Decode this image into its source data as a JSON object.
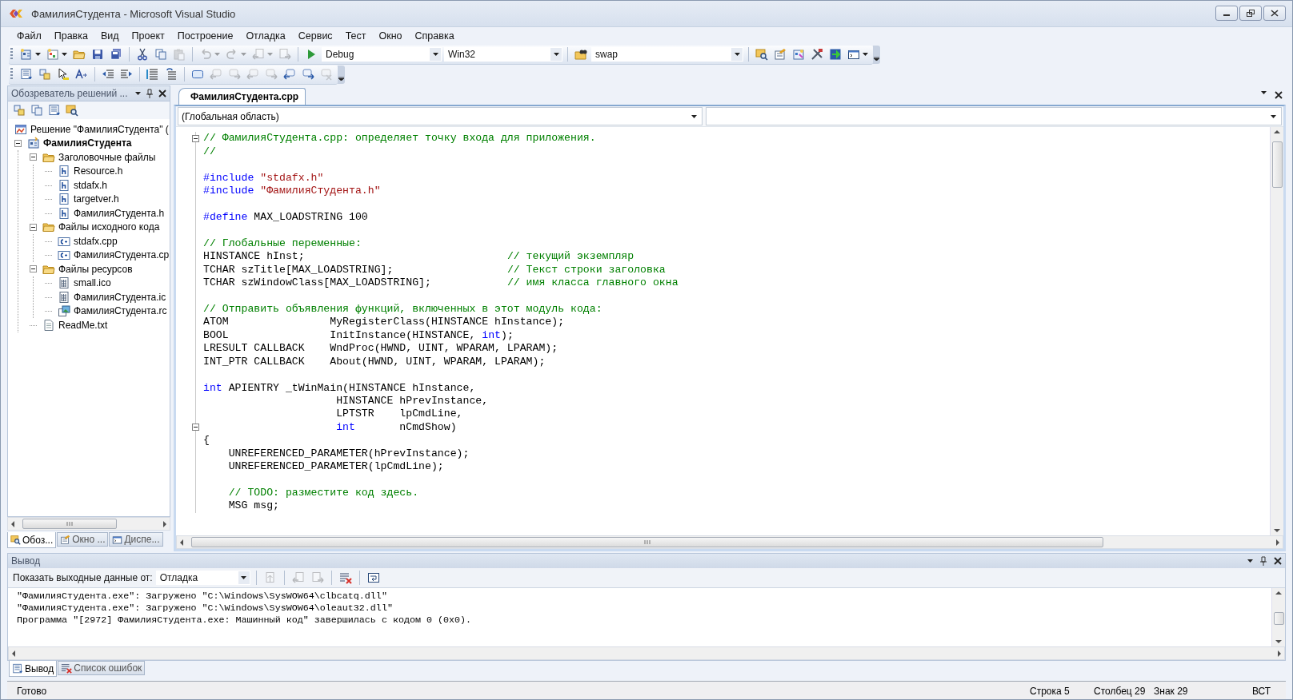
{
  "window": {
    "title": "ФамилияСтудента - Microsoft Visual Studio"
  },
  "menu": [
    "Файл",
    "Правка",
    "Вид",
    "Проект",
    "Построение",
    "Отладка",
    "Сервис",
    "Тест",
    "Окно",
    "Справка"
  ],
  "toolbar_standard": [
    {
      "kind": "button",
      "disabled": false,
      "dropdown": true
    },
    {
      "kind": "button",
      "disabled": false,
      "dropdown": true
    },
    {
      "kind": "button",
      "disabled": false,
      "dropdown": false
    },
    {
      "kind": "button",
      "disabled": false,
      "dropdown": false
    },
    {
      "kind": "button",
      "disabled": false,
      "dropdown": false
    },
    {
      "kind": "separator"
    },
    {
      "kind": "button",
      "disabled": false,
      "dropdown": false
    },
    {
      "kind": "button",
      "disabled": false,
      "dropdown": false
    },
    {
      "kind": "button",
      "disabled": true,
      "dropdown": false
    },
    {
      "kind": "separator"
    },
    {
      "kind": "button",
      "disabled": true,
      "dropdown": true
    },
    {
      "kind": "button",
      "disabled": true,
      "dropdown": true
    },
    {
      "kind": "button",
      "disabled": true,
      "dropdown": true
    },
    {
      "kind": "button",
      "disabled": true,
      "dropdown": false
    },
    {
      "kind": "separator"
    },
    {
      "kind": "button",
      "disabled": false,
      "dropdown": false
    },
    {
      "kind": "combo",
      "value": "Debug"
    },
    {
      "kind": "combo",
      "value": "Win32"
    },
    {
      "kind": "separator"
    },
    {
      "kind": "button",
      "disabled": false,
      "dropdown": false
    },
    {
      "kind": "combo",
      "value": "swap"
    },
    {
      "kind": "separator"
    },
    {
      "kind": "button",
      "disabled": false,
      "dropdown": false
    },
    {
      "kind": "button",
      "disabled": false,
      "dropdown": false
    },
    {
      "kind": "button",
      "disabled": false,
      "dropdown": false
    },
    {
      "kind": "button",
      "disabled": false,
      "dropdown": false
    },
    {
      "kind": "button",
      "disabled": false,
      "dropdown": false
    },
    {
      "kind": "button",
      "disabled": false,
      "dropdown": true
    }
  ],
  "toolbar_text_editor": [
    {
      "kind": "button",
      "disabled": false,
      "dropdown": false
    },
    {
      "kind": "button",
      "disabled": false,
      "dropdown": false
    },
    {
      "kind": "button",
      "disabled": false,
      "dropdown": false
    },
    {
      "kind": "button",
      "disabled": false,
      "dropdown": false
    },
    {
      "kind": "separator"
    },
    {
      "kind": "button",
      "disabled": false,
      "dropdown": false
    },
    {
      "kind": "button",
      "disabled": false,
      "dropdown": false
    },
    {
      "kind": "separator"
    },
    {
      "kind": "button",
      "disabled": false,
      "dropdown": false
    },
    {
      "kind": "button",
      "disabled": false,
      "dropdown": false
    },
    {
      "kind": "separator"
    },
    {
      "kind": "button",
      "disabled": false,
      "dropdown": false
    },
    {
      "kind": "button",
      "disabled": true,
      "dropdown": false
    },
    {
      "kind": "button",
      "disabled": true,
      "dropdown": false
    },
    {
      "kind": "button",
      "disabled": true,
      "dropdown": false
    },
    {
      "kind": "button",
      "disabled": true,
      "dropdown": false
    },
    {
      "kind": "button",
      "disabled": false,
      "dropdown": false
    },
    {
      "kind": "button",
      "disabled": false,
      "dropdown": false
    },
    {
      "kind": "button",
      "disabled": true,
      "dropdown": false
    }
  ],
  "solution_explorer": {
    "title": "Обозреватель решений ...",
    "root": "Решение \"ФамилияСтудента\" (",
    "tree": [
      {
        "kind": "project",
        "label": "ФамилияСтудента",
        "expanded": true,
        "children": [
          {
            "kind": "folder",
            "label": "Заголовочные файлы",
            "expanded": true,
            "children": [
              {
                "kind": "header",
                "label": "Resource.h"
              },
              {
                "kind": "header",
                "label": "stdafx.h"
              },
              {
                "kind": "header",
                "label": "targetver.h"
              },
              {
                "kind": "header",
                "label": "ФамилияСтудента.h"
              }
            ]
          },
          {
            "kind": "folder",
            "label": "Файлы исходного кода",
            "expanded": true,
            "children": [
              {
                "kind": "source",
                "label": "stdafx.cpp"
              },
              {
                "kind": "source",
                "label": "ФамилияСтудента.cp"
              }
            ]
          },
          {
            "kind": "folder",
            "label": "Файлы ресурсов",
            "expanded": true,
            "children": [
              {
                "kind": "icon",
                "label": "small.ico"
              },
              {
                "kind": "icon",
                "label": "ФамилияСтудента.ic"
              },
              {
                "kind": "resource",
                "label": "ФамилияСтудента.rc"
              }
            ]
          },
          {
            "kind": "text",
            "label": "ReadMe.txt"
          }
        ]
      }
    ],
    "tabs": [
      {
        "label": "Обоз...",
        "selected": true
      },
      {
        "label": "Окно ...",
        "selected": false
      },
      {
        "label": "Диспе...",
        "selected": false
      }
    ]
  },
  "editor": {
    "tabs": [
      {
        "label": "ФамилияСтудента.срр",
        "selected": true
      }
    ],
    "scope": "(Глобальная область)",
    "lines": [
      {
        "fold": true,
        "tokens": [
          {
            "kind": "comment",
            "text": "// ФамилияСтудента.cpp: определяет точку входа для приложения."
          }
        ]
      },
      {
        "fold": false,
        "tokens": [
          {
            "kind": "comment",
            "text": "//"
          }
        ]
      },
      {
        "fold": false
      },
      {
        "fold": false,
        "tokens": [
          {
            "kind": "keyword",
            "text": "#include "
          },
          {
            "kind": "string",
            "text": "\"stdafx.h\""
          }
        ]
      },
      {
        "fold": false,
        "tokens": [
          {
            "kind": "keyword",
            "text": "#include "
          },
          {
            "kind": "string",
            "text": "\"ФамилияСтудента.h\""
          }
        ]
      },
      {
        "fold": false
      },
      {
        "fold": false,
        "tokens": [
          {
            "kind": "keyword",
            "text": "#define"
          },
          {
            "kind": "plain",
            "text": " MAX_LOADSTRING 100"
          }
        ]
      },
      {
        "fold": false
      },
      {
        "fold": false,
        "tokens": [
          {
            "kind": "comment",
            "text": "// Глобальные переменные:"
          }
        ]
      },
      {
        "fold": false,
        "tokens": [
          {
            "kind": "plain",
            "text": "HINSTANCE hInst;                                "
          },
          {
            "kind": "comment",
            "text": "// текущий экземпляр"
          }
        ]
      },
      {
        "fold": false,
        "tokens": [
          {
            "kind": "plain",
            "text": "TCHAR szTitle[MAX_LOADSTRING];                  "
          },
          {
            "kind": "comment",
            "text": "// Текст строки заголовка"
          }
        ]
      },
      {
        "fold": false,
        "tokens": [
          {
            "kind": "plain",
            "text": "TCHAR szWindowClass[MAX_LOADSTRING];            "
          },
          {
            "kind": "comment",
            "text": "// имя класса главного окна"
          }
        ]
      },
      {
        "fold": false
      },
      {
        "fold": false,
        "tokens": [
          {
            "kind": "comment",
            "text": "// Отправить объявления функций, включенных в этот модуль кода:"
          }
        ]
      },
      {
        "fold": false,
        "tokens": [
          {
            "kind": "plain",
            "text": "ATOM                MyRegisterClass(HINSTANCE hInstance);"
          }
        ]
      },
      {
        "fold": false,
        "tokens": [
          {
            "kind": "plain",
            "text": "BOOL                InitInstance(HINSTANCE, "
          },
          {
            "kind": "keyword",
            "text": "int"
          },
          {
            "kind": "plain",
            "text": ");"
          }
        ]
      },
      {
        "fold": false,
        "tokens": [
          {
            "kind": "plain",
            "text": "LRESULT CALLBACK    WndProc(HWND, UINT, WPARAM, LPARAM);"
          }
        ]
      },
      {
        "fold": false,
        "tokens": [
          {
            "kind": "plain",
            "text": "INT_PTR CALLBACK    About(HWND, UINT, WPARAM, LPARAM);"
          }
        ]
      },
      {
        "fold": false
      },
      {
        "fold": false,
        "tokens": [
          {
            "kind": "keyword",
            "text": "int"
          },
          {
            "kind": "plain",
            "text": " APIENTRY _tWinMain(HINSTANCE hInstance,"
          }
        ]
      },
      {
        "fold": false,
        "tokens": [
          {
            "kind": "plain",
            "text": "                     HINSTANCE hPrevInstance,"
          }
        ]
      },
      {
        "fold": false,
        "tokens": [
          {
            "kind": "plain",
            "text": "                     LPTSTR    lpCmdLine,"
          }
        ]
      },
      {
        "fold": true,
        "tokens": [
          {
            "kind": "keyword",
            "text": "                     int"
          },
          {
            "kind": "plain",
            "text": "       nCmdShow)"
          }
        ]
      },
      {
        "fold": false,
        "tokens": [
          {
            "kind": "plain",
            "text": "{"
          }
        ]
      },
      {
        "fold": false,
        "tokens": [
          {
            "kind": "plain",
            "text": "    UNREFERENCED_PARAMETER(hPrevInstance);"
          }
        ]
      },
      {
        "fold": false,
        "tokens": [
          {
            "kind": "plain",
            "text": "    UNREFERENCED_PARAMETER(lpCmdLine);"
          }
        ]
      },
      {
        "fold": false
      },
      {
        "fold": false,
        "tokens": [
          {
            "kind": "comment",
            "text": "    // TODO: разместите код здесь."
          }
        ]
      },
      {
        "fold": false,
        "tokens": [
          {
            "kind": "plain",
            "text": "    MSG msg;"
          }
        ]
      }
    ]
  },
  "output": {
    "title": "Вывод",
    "source_label": "Показать выходные данные от:",
    "source": "Отладка",
    "toolbar": [
      {
        "kind": "button",
        "disabled": true,
        "dropdown": false
      },
      {
        "kind": "separator"
      },
      {
        "kind": "button",
        "disabled": true,
        "dropdown": false
      },
      {
        "kind": "button",
        "disabled": true,
        "dropdown": false
      },
      {
        "kind": "separator"
      },
      {
        "kind": "button",
        "disabled": false,
        "dropdown": false
      },
      {
        "kind": "separator"
      },
      {
        "kind": "button",
        "disabled": false,
        "dropdown": false
      }
    ],
    "lines": [
      "\"ФамилияСтудента.exe\": Загружено \"C:\\Windows\\SysWOW64\\clbcatq.dll\"",
      "\"ФамилияСтудента.exe\": Загружено \"C:\\Windows\\SysWOW64\\oleaut32.dll\"",
      "Программа \"[2972] ФамилияСтудента.exe: Машинный код\" завершилась с кодом 0 (0x0)."
    ],
    "tabs": [
      {
        "label": "Вывод",
        "selected": true
      },
      {
        "label": "Список ошибок",
        "selected": false
      }
    ]
  },
  "status_bar": {
    "message": "Готово",
    "line": "Строка 5",
    "column": "Столбец 29",
    "char": "Знак 29",
    "mode": "ВСТ"
  }
}
